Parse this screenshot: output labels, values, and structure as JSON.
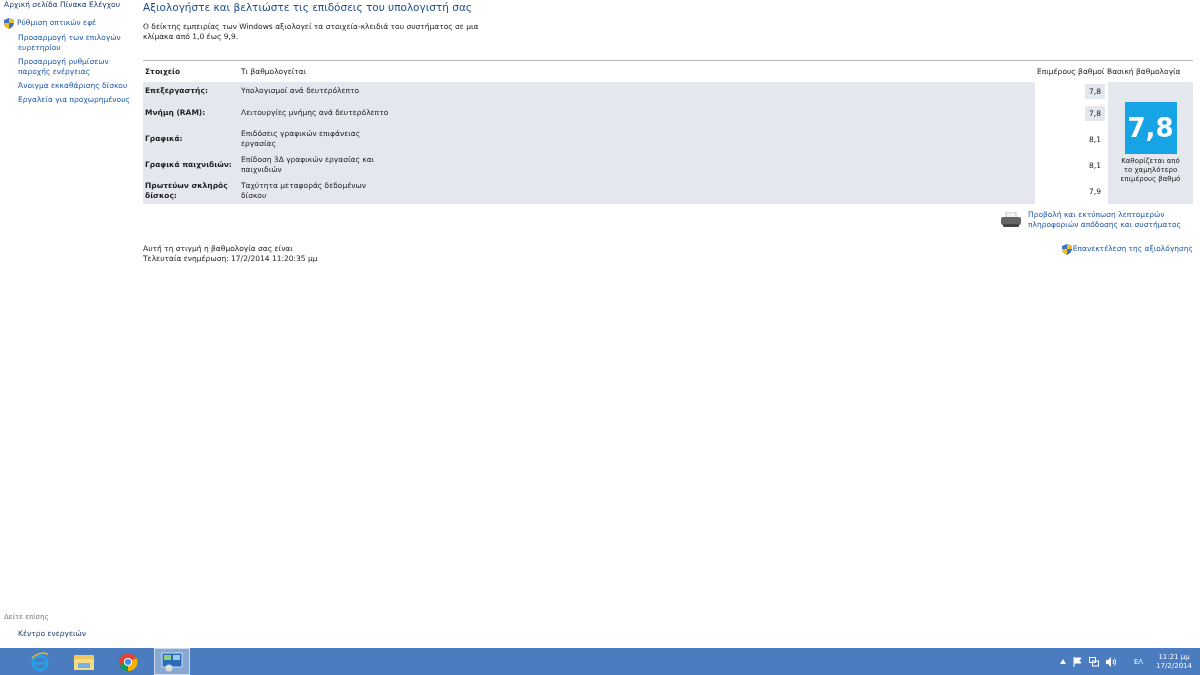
{
  "sidebar": {
    "home_link": "Αρχική σελίδα Πίνακα Ελέγχου",
    "items": [
      {
        "label": "Ρύθμιση οπτικών εφέ",
        "shield": true
      },
      {
        "label": "Προσαρμογή των επιλογών ευρετηρίου",
        "shield": false
      },
      {
        "label": "Προσαρμογή ρυθμίσεων παροχής ενέργειας",
        "shield": false
      },
      {
        "label": "Άνοιγμα εκκαθάρισης δίσκου",
        "shield": false
      },
      {
        "label": "Εργαλεία για προχωρημένους",
        "shield": false
      }
    ],
    "see_also_title": "Δείτε επίσης",
    "see_also": [
      "Κέντρο ενεργειών"
    ]
  },
  "main": {
    "title": "Αξιολογήστε και βελτιώστε τις επιδόσεις του υπολογιστή σας",
    "intro": "Ο δείκτης εμπειρίας των Windows αξιολογεί τα στοιχεία-κλειδιά του συστήματος σε μια κλίμακα από 1,0 έως 9,9.",
    "table": {
      "columns": [
        "Στοιχείο",
        "Τι βαθμολογείται",
        "Επιμέρους βαθμοί",
        "Βασική βαθμολογία"
      ],
      "rows": [
        {
          "component": "Επεξεργαστής:",
          "rated": "Υπολογισμοί ανά δευτερόλεπτο",
          "subscore": "7,8",
          "lowest": true
        },
        {
          "component": "Μνήμη (RAM):",
          "rated": "Λειτουργίες μνήμης ανά δευτερόλεπτο",
          "subscore": "7,8",
          "lowest": true
        },
        {
          "component": "Γραφικά:",
          "rated": "Επιδόσεις γραφικών επιφάνειας εργασίας",
          "subscore": "8,1",
          "lowest": false
        },
        {
          "component": "Γραφικά παιχνιδιών:",
          "rated": "Επίδοση 3Δ γραφικών εργασίας και παιχνιδιών",
          "subscore": "8,1",
          "lowest": false
        },
        {
          "component": "Πρωτεύων σκληρός δίσκος:",
          "rated": "Ταχύτητα μεταφοράς δεδομένων δίσκου",
          "subscore": "7,9",
          "lowest": false
        }
      ],
      "base_score": "7,8",
      "base_note": "Καθορίζεται από το χαμηλότερο επιμέρους βαθμό"
    },
    "details_link": "Προβολή και εκτύπωση λεπτομερών πληροφοριών απόδοσης και συστήματος",
    "status": "Αυτή τη στιγμή η βαθμολογία σας είναι",
    "updated": "Τελευταία ενημέρωση: 17/2/2014 11:20:35 μμ",
    "rerun_link": "Επανεκτέλεση της αξιολόγησης"
  },
  "taskbar": {
    "apps": [
      {
        "kind": "ie",
        "selected": false
      },
      {
        "kind": "folder",
        "selected": false
      },
      {
        "kind": "chrome",
        "selected": false
      },
      {
        "kind": "panel",
        "selected": true
      }
    ],
    "language": "ΕΛ",
    "time": "11:21 μμ",
    "date": "17/2/2014"
  }
}
